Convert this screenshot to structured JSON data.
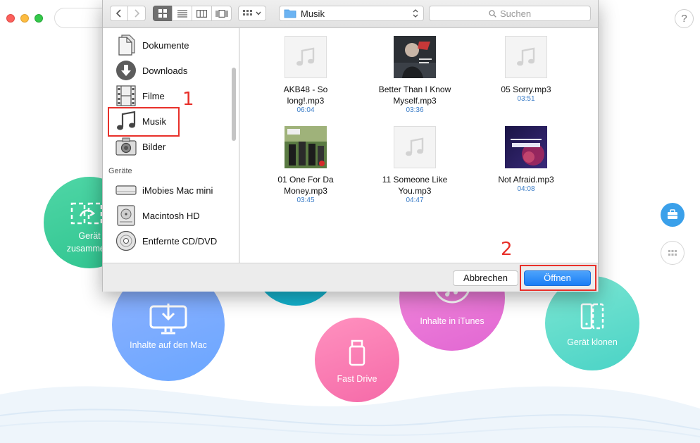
{
  "background": {
    "help_label": "?",
    "circles": {
      "merge": "Gerät\nzusammenf",
      "merge_line1": "Gerät",
      "merge_line2": "zusammenf",
      "mac": "Inhalte auf den Mac",
      "itunes": "Inhalte in iTunes",
      "drive": "Fast Drive",
      "clone": "Gerät klonen"
    },
    "colors": {
      "toolbox": "#3aa0ea"
    }
  },
  "toolbar": {
    "path": "Musik",
    "search_placeholder": "Suchen"
  },
  "sidebar": {
    "favorites": [
      {
        "label": "Dokumente",
        "icon": "document-icon"
      },
      {
        "label": "Downloads",
        "icon": "download-icon"
      },
      {
        "label": "Filme",
        "icon": "film-icon"
      },
      {
        "label": "Musik",
        "icon": "music-note-icon"
      },
      {
        "label": "Bilder",
        "icon": "camera-icon"
      }
    ],
    "devices_header": "Geräte",
    "devices": [
      {
        "label": "iMobies Mac mini",
        "icon": "mac-mini-icon"
      },
      {
        "label": "Macintosh HD",
        "icon": "hard-drive-icon"
      },
      {
        "label": "Entfernte CD/DVD",
        "icon": "disc-icon"
      }
    ]
  },
  "files": [
    {
      "line1": "AKB48 - So",
      "line2": "long!.mp3",
      "duration": "06:04",
      "thumb": "generic-music"
    },
    {
      "line1": "Better Than I Know",
      "line2": "Myself.mp3",
      "duration": "03:36",
      "thumb": "album-cover"
    },
    {
      "line1": "05 Sorry.mp3",
      "line2": "",
      "duration": "03:51",
      "thumb": "generic-music"
    },
    {
      "line1": "01 One For Da",
      "line2": "Money.mp3",
      "duration": "03:45",
      "thumb": "album-cover"
    },
    {
      "line1": "11 Someone Like",
      "line2": "You.mp3",
      "duration": "04:47",
      "thumb": "generic-music"
    },
    {
      "line1": "Not Afraid.mp3",
      "line2": "",
      "duration": "04:08",
      "thumb": "album-cover"
    }
  ],
  "buttons": {
    "cancel": "Abbrechen",
    "open": "Öffnen"
  },
  "annotations": {
    "step1": "1",
    "step2": "2",
    "highlight_color": "#e8302a"
  }
}
